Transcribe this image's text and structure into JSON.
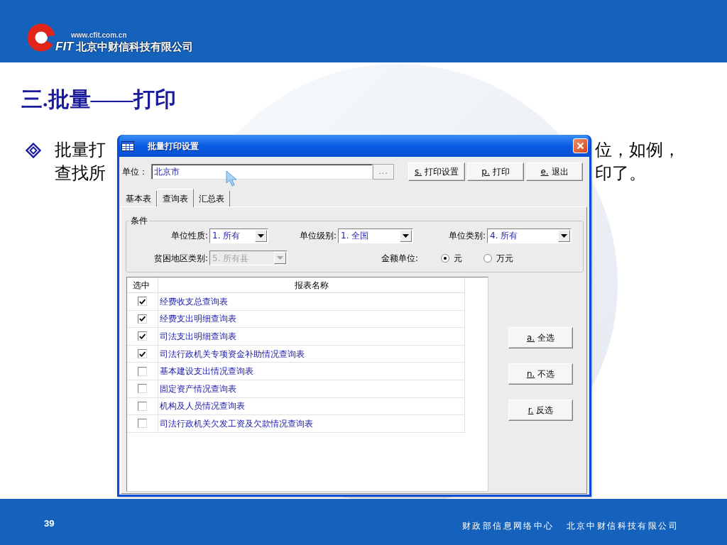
{
  "header": {
    "url": "www.cfit.com.cn",
    "logo_letters": "FIT",
    "company": "北京中财信科技有限公司"
  },
  "title": "三.批量——打印",
  "bullet_lines": [
    {
      "left": "批量打",
      "right": "位，如例，"
    },
    {
      "left": "查找所",
      "right": "印了。"
    }
  ],
  "dialog": {
    "title": "批量打印设置",
    "unit": {
      "label": "单位：",
      "value": "北京市",
      "browse": "..."
    },
    "buttons": [
      "s. 打印设置",
      "p. 打印",
      "e. 退出"
    ],
    "tabs": [
      {
        "label": "基本表",
        "selected": false
      },
      {
        "label": "查询表",
        "selected": true
      },
      {
        "label": "汇总表",
        "selected": false
      }
    ],
    "conditions": {
      "title": "条件",
      "fields": [
        {
          "label": "单位性质:",
          "value": "1. 所有",
          "disabled": false
        },
        {
          "label": "单位级别:",
          "value": "1. 全国",
          "disabled": false
        },
        {
          "label": "单位类别:",
          "value": "4. 所有",
          "disabled": false
        },
        {
          "label": "贫困地区类别:",
          "value": "5. 所有县",
          "disabled": true
        }
      ],
      "amount_unit": {
        "label": "金额单位:",
        "options": [
          {
            "label": "元",
            "selected": true
          },
          {
            "label": "万元",
            "selected": false
          }
        ]
      }
    },
    "table": {
      "columns": [
        "选中",
        "报表名称"
      ],
      "rows": [
        {
          "name": "经费收支总查询表",
          "checked": true
        },
        {
          "name": "经费支出明细查询表",
          "checked": true
        },
        {
          "name": "司法支出明细查询表",
          "checked": true
        },
        {
          "name": "司法行政机关专项资金补助情况查询表",
          "checked": true
        },
        {
          "name": "基本建设支出情况查询表",
          "checked": false
        },
        {
          "name": "固定资产情况查询表",
          "checked": false
        },
        {
          "name": "机构及人员情况查询表",
          "checked": false
        },
        {
          "name": "司法行政机关欠发工资及欠款情况查询表",
          "checked": false
        }
      ]
    },
    "side_buttons": [
      "a. 全选",
      "n. 不选",
      "r. 反选"
    ]
  },
  "footer": {
    "page": "39",
    "texts": [
      "财政部信息网络中心",
      "北京中财信科技有限公司"
    ]
  }
}
